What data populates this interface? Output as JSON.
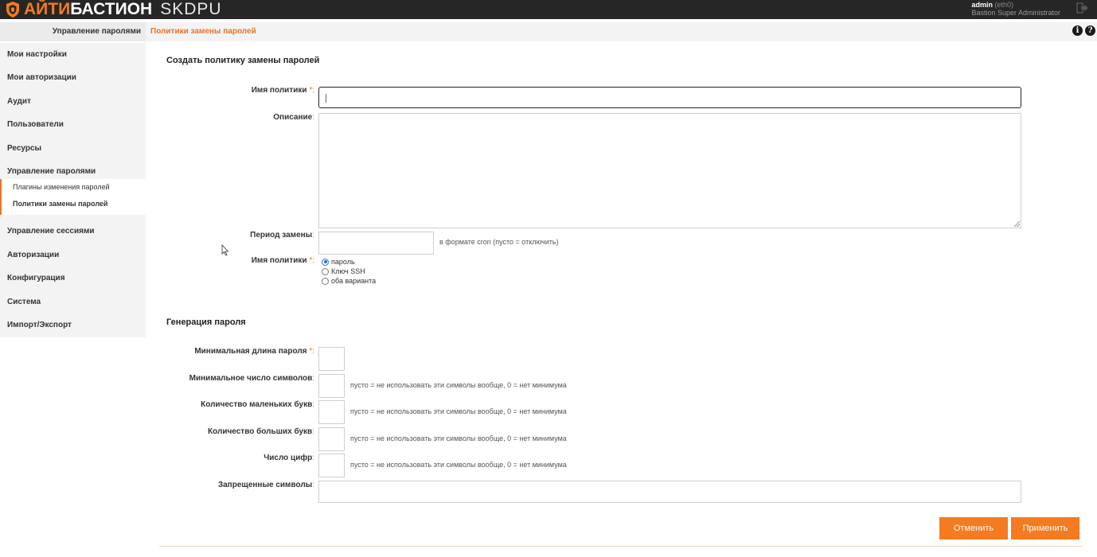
{
  "header": {
    "brand_part1": "АЙТИ",
    "brand_part2": "БАСТИОН",
    "product": "SKDPU",
    "user_name": "admin",
    "user_interface": "(eth0)",
    "user_role": "Bastion Super Administrator",
    "logout_icon": "logout-icon"
  },
  "breadcrumb": {
    "section": "Управление паролями",
    "current": "Политики замены паролей"
  },
  "sidebar": {
    "items": [
      {
        "label": "Мои настройки"
      },
      {
        "label": "Мои авторизации"
      },
      {
        "label": "Аудит"
      },
      {
        "label": "Пользователи"
      },
      {
        "label": "Ресурсы"
      },
      {
        "label": "Управление паролями"
      },
      {
        "label": "Управление сессиями"
      },
      {
        "label": "Авторизации"
      },
      {
        "label": "Конфигурация"
      },
      {
        "label": "Система"
      },
      {
        "label": "Импорт/Экспорт"
      }
    ],
    "sub_items": [
      {
        "label": "Плагины изменения паролей"
      },
      {
        "label": "Политики замены паролей"
      }
    ]
  },
  "form": {
    "title": "Создать политику замены паролей",
    "policy_name_label": "Имя политики",
    "policy_name_value": "",
    "description_label": "Описание",
    "description_value": "",
    "period_label": "Период замены",
    "period_value": "",
    "period_hint": "в формате cron (пусто = отключить)",
    "type_label": "Имя политики",
    "type_options": [
      "пароль",
      "Ключ SSH",
      "оба варианта"
    ],
    "type_selected": "пароль",
    "required_mark": "*",
    "colon": ":"
  },
  "generation": {
    "title": "Генерация пароля",
    "min_length_label": "Минимальная длина пароля",
    "min_symbols_label": "Минимальное число символов",
    "lowercase_label": "Количество маленьких букв",
    "uppercase_label": "Количество больших букв",
    "digits_label": "Число цифр",
    "forbidden_label": "Запрещенные символы",
    "count_hint": "пусто = не использовать эти символы вообще, 0 = нет минимума"
  },
  "buttons": {
    "cancel": "Отменить",
    "apply": "Применить"
  },
  "colors": {
    "accent": "#f47b20",
    "topbar": "#262626",
    "sidebar_bg": "#f3f3f3"
  }
}
